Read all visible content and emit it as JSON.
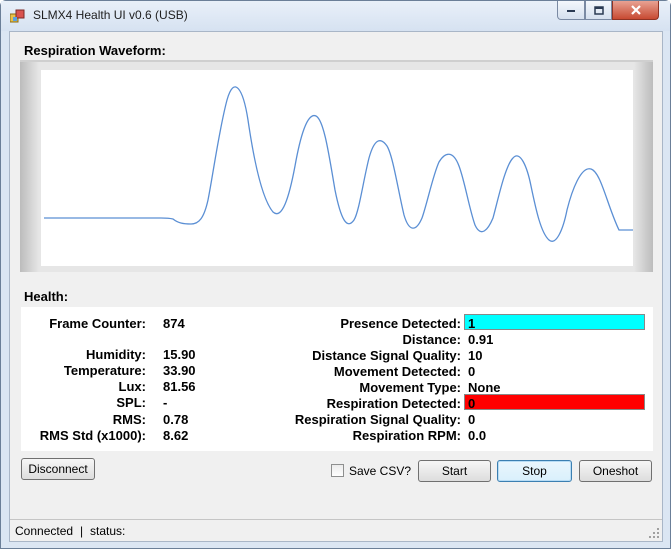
{
  "window": {
    "title": "SLMX4 Health UI v0.6 (USB)"
  },
  "waveform": {
    "label": "Respiration Waveform:",
    "line_color": "#5b8fd4"
  },
  "health": {
    "label": "Health:",
    "left_metrics": [
      {
        "label": "Frame Counter:",
        "value": "874"
      },
      {
        "label": "Humidity:",
        "value": "15.90"
      },
      {
        "label": "Temperature:",
        "value": "33.90"
      },
      {
        "label": "Lux:",
        "value": "81.56"
      },
      {
        "label": "SPL:",
        "value": "-"
      },
      {
        "label": "RMS:",
        "value": "0.78"
      },
      {
        "label": "RMS Std (x1000):",
        "value": "8.62"
      }
    ],
    "right_metrics": [
      {
        "label": "Presence Detected:",
        "value": "1",
        "bar_color": "#00ffff"
      },
      {
        "label": "Distance:",
        "value": "0.91"
      },
      {
        "label": "Distance Signal Quality:",
        "value": "10"
      },
      {
        "label": "Movement Detected:",
        "value": "0"
      },
      {
        "label": "Movement Type:",
        "value": "None"
      },
      {
        "label": "Respiration Detected:",
        "value": "0",
        "bar_color": "#ff0000"
      },
      {
        "label": "Respiration Signal Quality:",
        "value": "0"
      },
      {
        "label": "Respiration RPM:",
        "value": "0.0"
      }
    ]
  },
  "controls": {
    "disconnect_label": "Disconnect",
    "save_csv_label": "Save CSV?",
    "save_csv_checked": false,
    "start_label": "Start",
    "stop_label": "Stop",
    "oneshot_label": "Oneshot"
  },
  "status": {
    "connection": "Connected",
    "separator": "|",
    "status_label": "status:"
  }
}
